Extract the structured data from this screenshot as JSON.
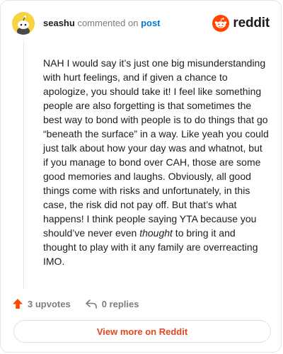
{
  "comment": {
    "author": "seashu",
    "action_text": "commented on",
    "post_link": "post",
    "body_before_italic": "NAH I would say it’s just one big misunderstanding with hurt feelings, and if given a chance to apologize, you should take it! I feel like something people are also forgetting is that sometimes the best way to bond with people is to do things that go “beneath the surface” in a way. Like yeah you could just talk about how your day was and whatnot, but if you manage to bond over CAH, those are some good memories and laughs. Obviously, all good things come with risks and unfortunately, in this case, the risk did not pay off. But that’s what happens! I think people saying YTA because you should’ve never even ",
    "body_italic": "thought",
    "body_after_italic": " to bring it and thought to play with it any family are overreacting IMO."
  },
  "brand": {
    "wordmark": "reddit",
    "color": "#ff4500"
  },
  "actions": {
    "upvote_icon": "upvote-arrow-icon",
    "upvotes_label": "3 upvotes",
    "reply_icon": "reply-icon",
    "replies_label": "0 replies"
  },
  "footer": {
    "view_more_label": "View more on Reddit"
  }
}
